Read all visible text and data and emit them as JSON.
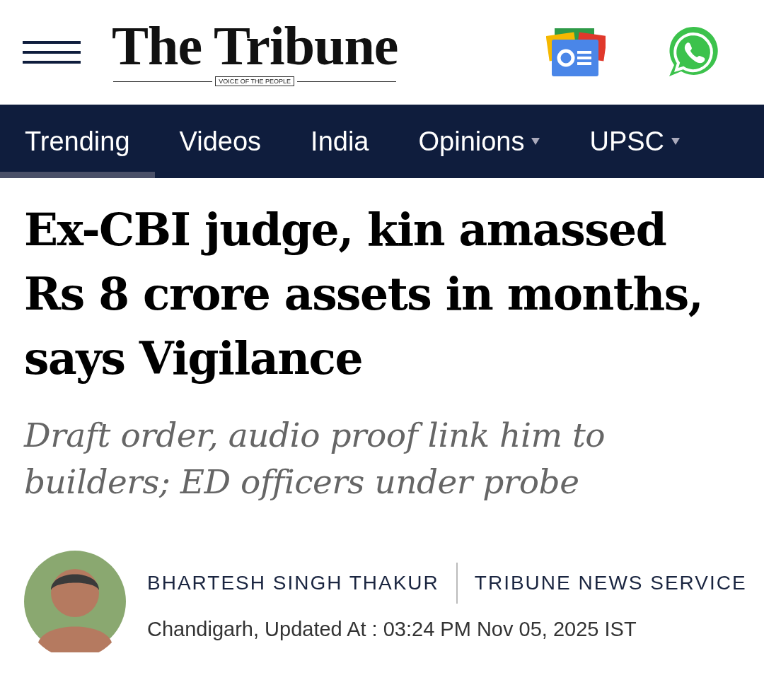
{
  "header": {
    "logo": "The Tribune",
    "tagline": "VOICE OF THE PEOPLE"
  },
  "nav": [
    {
      "label": "Trending",
      "selected": true,
      "dropdown": false
    },
    {
      "label": "Videos",
      "selected": false,
      "dropdown": false
    },
    {
      "label": "India",
      "selected": false,
      "dropdown": false
    },
    {
      "label": "Opinions",
      "selected": false,
      "dropdown": true
    },
    {
      "label": "UPSC",
      "selected": false,
      "dropdown": true
    }
  ],
  "article": {
    "headline": "Ex-CBI judge, kin amassed Rs 8 crore assets in months, says Vigilance",
    "subheadline": "Draft order, audio proof link him to builders; ED officers under probe",
    "author": "BHARTESH SINGH THAKUR",
    "agency": "TRIBUNE NEWS SERVICE",
    "dateline": "Chandigarh, Updated At : 03:24 PM Nov 05, 2025 IST"
  }
}
